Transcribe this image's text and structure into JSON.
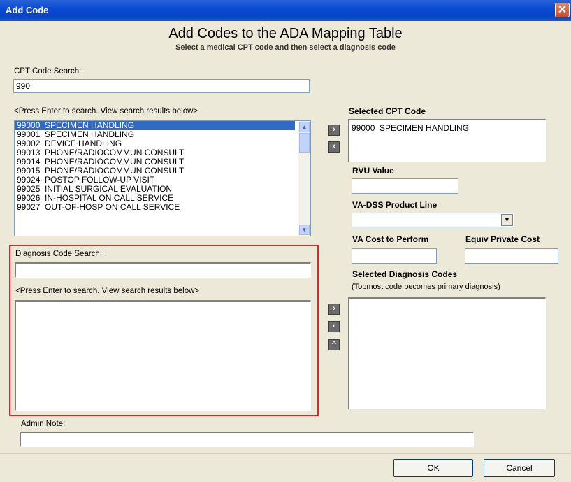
{
  "window": {
    "title": "Add Code"
  },
  "header": {
    "title": "Add Codes to the ADA Mapping Table",
    "subtitle": "Select a medical CPT code and then select a diagnosis code"
  },
  "cpt_search": {
    "label": "CPT Code Search:",
    "value": "990",
    "hint": "<Press Enter to search.  View search results below>",
    "results": [
      "99000  SPECIMEN HANDLING",
      "99001  SPECIMEN HANDLING",
      "99002  DEVICE HANDLING",
      "99013  PHONE/RADIOCOMMUN CONSULT",
      "99014  PHONE/RADIOCOMMUN CONSULT",
      "99015  PHONE/RADIOCOMMUN CONSULT",
      "99024  POSTOP FOLLOW-UP VISIT",
      "99025  INITIAL SURGICAL EVALUATION",
      "99026  IN-HOSPITAL ON CALL SERVICE",
      "99027  OUT-OF-HOSP ON CALL SERVICE"
    ],
    "selected_index": 0
  },
  "selected_cpt": {
    "label": "Selected CPT Code",
    "value": "99000  SPECIMEN HANDLING"
  },
  "rvu": {
    "label": "RVU Value",
    "value": ""
  },
  "product_line": {
    "label": "VA-DSS Product Line",
    "value": ""
  },
  "va_cost": {
    "label": "VA Cost to Perform",
    "value": ""
  },
  "private_cost": {
    "label": "Equiv Private Cost",
    "value": ""
  },
  "diagnosis_search": {
    "label": "Diagnosis Code Search:",
    "value": "",
    "hint": "<Press Enter to search.  View search results below>"
  },
  "selected_diagnosis": {
    "label": "Selected Diagnosis Codes",
    "note": "(Topmost code becomes primary diagnosis)"
  },
  "admin_note": {
    "label": "Admin Note:",
    "value": ""
  },
  "buttons": {
    "ok": "OK",
    "cancel": "Cancel"
  },
  "icons": {
    "add": "chevron-right-icon",
    "remove": "chevron-left-icon",
    "move_up": "caret-up-icon"
  },
  "colors": {
    "highlight": "#e8202a",
    "selection": "#316ac5",
    "titlebar": "#0a4ad4"
  }
}
